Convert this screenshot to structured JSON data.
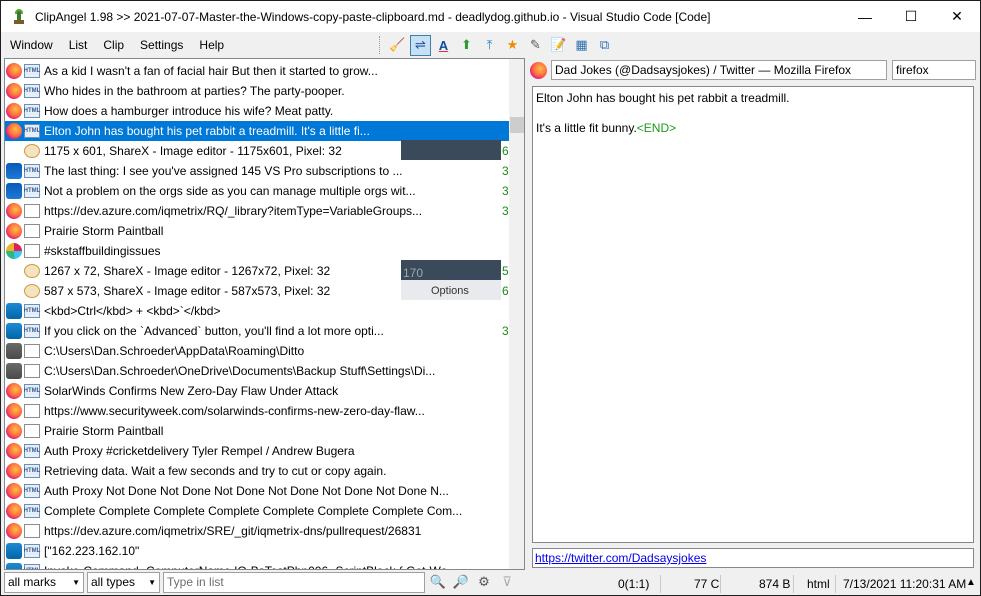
{
  "window": {
    "title": "ClipAngel 1.98 >> 2021-07-07-Master-the-Windows-copy-paste-clipboard.md - deadlydog.github.io - Visual Studio Code [Code]",
    "minimize": "—",
    "maximize": "☐",
    "close": "✕"
  },
  "menu": [
    "Window",
    "List",
    "Clip",
    "Settings",
    "Help"
  ],
  "toolbar": [
    {
      "icon": "broom-icon",
      "glyph": "🧹"
    },
    {
      "icon": "word-wrap-icon",
      "glyph": "⇌",
      "active": true
    },
    {
      "icon": "text-color-icon",
      "glyph": "A"
    },
    {
      "icon": "arrow-up-green-icon",
      "glyph": "⬆"
    },
    {
      "icon": "arrow-top-blue-icon",
      "glyph": "⤒"
    },
    {
      "icon": "star-icon",
      "glyph": "★"
    },
    {
      "icon": "pencil-icon",
      "glyph": "✎"
    },
    {
      "icon": "edit-document-icon",
      "glyph": "📝"
    },
    {
      "icon": "table-icon",
      "glyph": "▦"
    },
    {
      "icon": "windows-icon",
      "glyph": "⧉"
    }
  ],
  "list": {
    "items": [
      {
        "app": "firefox",
        "type": "HTML",
        "text": "As a kid I wasn't a fan of facial hair But then it started to grow...",
        "count": ""
      },
      {
        "app": "firefox",
        "type": "HTML",
        "text": "Who hides in the bathroom at parties? The party-pooper.",
        "count": ""
      },
      {
        "app": "firefox",
        "type": "HTML",
        "text": "How does a hamburger introduce his wife? Meat patty.",
        "count": ""
      },
      {
        "app": "firefox",
        "type": "HTML",
        "text": "Elton John has bought his pet rabbit a treadmill. It's a little fi...",
        "count": "",
        "selected": true
      },
      {
        "app": "",
        "type": "IMG",
        "text": "1175 x 601, ShareX - Image editor - 1175x601, Pixel: 32",
        "count": "6"
      },
      {
        "app": "outlook",
        "type": "HTML",
        "text": "The last thing: I see you've assigned 145 VS Pro subscriptions to ...",
        "count": "3"
      },
      {
        "app": "outlook",
        "type": "HTML",
        "text": "Not a problem on the orgs side as you can manage multiple orgs wit...",
        "count": "3"
      },
      {
        "app": "firefox",
        "type": "DOC",
        "text": "https://dev.azure.com/iqmetrix/RQ/_library?itemType=VariableGroups...",
        "count": "3"
      },
      {
        "app": "firefox",
        "type": "DOC",
        "text": "Prairie Storm Paintball",
        "count": ""
      },
      {
        "app": "slack",
        "type": "DOC",
        "text": "#skstaffbuildingissues",
        "count": ""
      },
      {
        "app": "",
        "type": "IMG",
        "text": "1267 x 72, ShareX - Image editor - 1267x72, Pixel: 32",
        "count": "5"
      },
      {
        "app": "",
        "type": "IMG",
        "text": "587 x 573, ShareX - Image editor - 587x573, Pixel: 32",
        "count": "6"
      },
      {
        "app": "vscode",
        "type": "HTML",
        "text": "<kbd>Ctrl</kbd> + <kbd>`</kbd>",
        "count": ""
      },
      {
        "app": "vscode",
        "type": "HTML",
        "text": "If you click on the `Advanced` button, you'll find a lot more opti...",
        "count": "3"
      },
      {
        "app": "ditto",
        "type": "DOC",
        "text": "C:\\Users\\Dan.Schroeder\\AppData\\Roaming\\Ditto",
        "count": ""
      },
      {
        "app": "ditto",
        "type": "DOC",
        "text": "C:\\Users\\Dan.Schroeder\\OneDrive\\Documents\\Backup Stuff\\Settings\\Di...",
        "count": ""
      },
      {
        "app": "firefox",
        "type": "HTML",
        "text": "SolarWinds Confirms New Zero-Day Flaw Under Attack",
        "count": ""
      },
      {
        "app": "firefox",
        "type": "DOC",
        "text": "https://www.securityweek.com/solarwinds-confirms-new-zero-day-flaw...",
        "count": ""
      },
      {
        "app": "firefox",
        "type": "DOC",
        "text": "Prairie Storm Paintball",
        "count": ""
      },
      {
        "app": "firefox",
        "type": "HTML",
        "text": "Auth Proxy #cricketdelivery Tyler Rempel / Andrew Bugera",
        "count": ""
      },
      {
        "app": "firefox",
        "type": "HTML",
        "text": "Retrieving data. Wait a few seconds and try to cut or copy again.",
        "count": ""
      },
      {
        "app": "firefox",
        "type": "HTML",
        "text": "Auth Proxy Not Done Not Done Not Done Not Done Not Done Not Done N...",
        "count": ""
      },
      {
        "app": "firefox",
        "type": "HTML",
        "text": "Complete Complete Complete Complete Complete Complete Complete Com...",
        "count": ""
      },
      {
        "app": "firefox",
        "type": "DOC",
        "text": "https://dev.azure.com/iqmetrix/SRE/_git/iqmetrix-dns/pullrequest/26831",
        "count": ""
      },
      {
        "app": "vscode",
        "type": "HTML",
        "text": "[\"162.223.162.10\"",
        "count": ""
      },
      {
        "app": "vscode",
        "type": "HTML",
        "text": "Invoke-Command -ComputerName IQ-BsTestPhp006 -ScriptBlock { Get-Wo...",
        "count": ""
      }
    ],
    "thumb_text_1": "170",
    "thumb_text_2": "Options"
  },
  "filters": {
    "marks": "all marks",
    "types": "all types",
    "search_placeholder": "Type in list"
  },
  "detail": {
    "window_title": "Dad Jokes (@Dadsaysjokes) / Twitter — Mozilla Firefox",
    "process": "firefox",
    "text": "Elton John has bought his pet rabbit a treadmill.\n\nIt's a little fit bunny.",
    "end_marker": "<END>",
    "url": "https://twitter.com/Dadsaysjokes"
  },
  "status": {
    "position": "0(1:1)",
    "chars": "77 C",
    "size": "874 B",
    "format": "html",
    "datetime": "7/13/2021 11:20:31 AM",
    "sort_glyph": "▲"
  },
  "colors": {
    "selection": "#0078d7",
    "count_green": "#1a8a1a",
    "end_green": "#1a9a1a"
  }
}
